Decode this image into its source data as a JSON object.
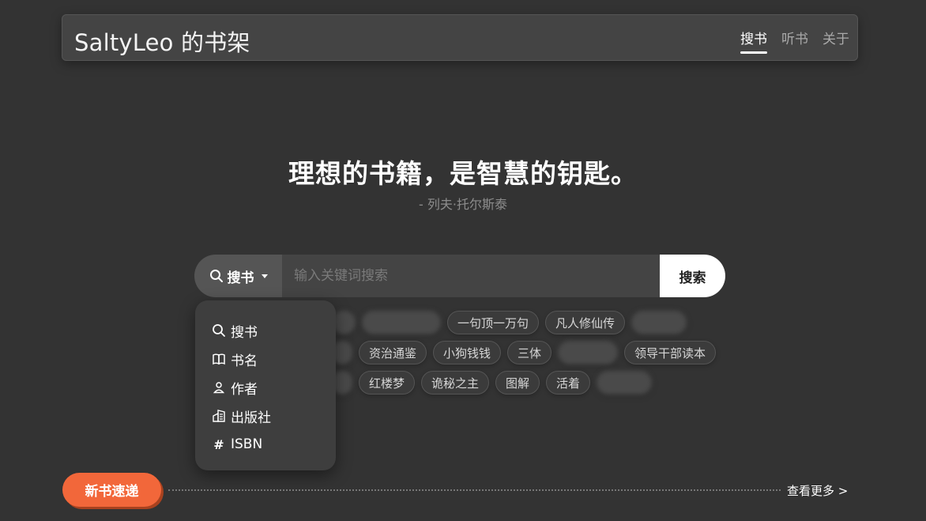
{
  "header": {
    "title": "SaltyLeo 的书架",
    "nav": [
      "搜书",
      "听书",
      "关于"
    ]
  },
  "hero": {
    "quote": "理想的书籍，是智慧的钥匙。",
    "author": "- 列夫·托尔斯泰"
  },
  "search": {
    "type_label": "搜书",
    "placeholder": "输入关键词搜索",
    "button_label": "搜索"
  },
  "dropdown": {
    "items": [
      {
        "label": "搜书",
        "icon": "search-icon"
      },
      {
        "label": "书名",
        "icon": "book-icon"
      },
      {
        "label": "作者",
        "icon": "person-icon"
      },
      {
        "label": "出版社",
        "icon": "building-icon"
      },
      {
        "label": "ISBN",
        "icon": "hash-icon"
      }
    ]
  },
  "tags": {
    "row1": [
      "一句顶一万句",
      "凡人修仙传"
    ],
    "row2": [
      "资治通鉴",
      "小狗钱钱",
      "三体",
      "领导干部读本"
    ],
    "row3": [
      "红楼梦",
      "诡秘之主",
      "图解",
      "活着"
    ]
  },
  "bottom": {
    "section_label": "新书速递",
    "more_link": "查看更多 >"
  },
  "colors": {
    "background": "#333333",
    "accent": "#f2673a"
  }
}
